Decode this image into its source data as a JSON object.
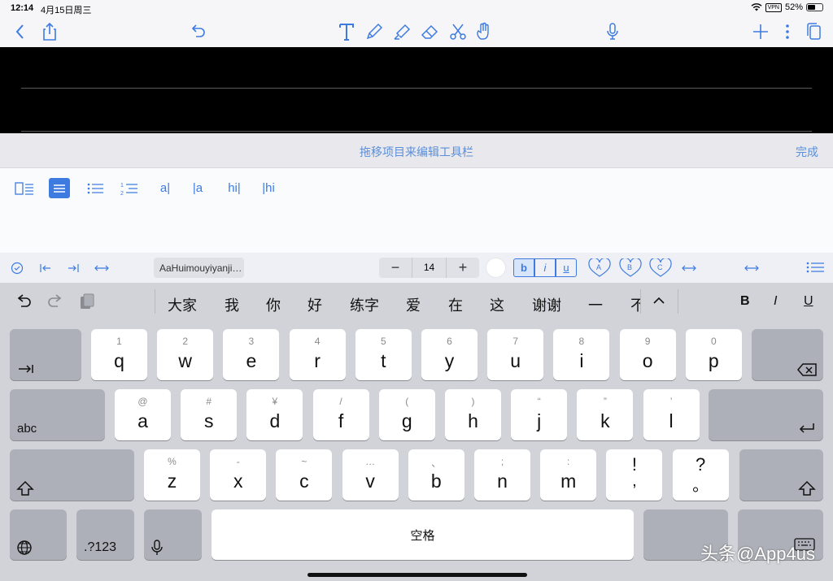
{
  "status": {
    "time": "12:14",
    "date": "4月15日周三",
    "vpn": "VPN",
    "battery_text": "52%",
    "battery_level": 0.52
  },
  "edit_bar": {
    "title": "拖移项目来编辑工具栏",
    "done": "完成"
  },
  "palette": {
    "items": [
      "a|",
      "|a",
      "hi|",
      "|hi"
    ]
  },
  "format": {
    "font_name": "AaHuimouyiyanji…",
    "font_size": "14",
    "minus": "−",
    "plus": "+",
    "bold": "b",
    "italic": "i",
    "underline": "u",
    "style_a": "A",
    "style_b": "B",
    "style_c": "C"
  },
  "candidates": {
    "words": [
      "大家",
      "我",
      "你",
      "好",
      "练字",
      "爱",
      "在",
      "这",
      "谢谢",
      "一",
      "不"
    ],
    "bold": "B",
    "italic": "I",
    "underline": "U"
  },
  "keyboard": {
    "row1": [
      [
        "1",
        "q"
      ],
      [
        "2",
        "w"
      ],
      [
        "3",
        "e"
      ],
      [
        "4",
        "r"
      ],
      [
        "5",
        "t"
      ],
      [
        "6",
        "y"
      ],
      [
        "7",
        "u"
      ],
      [
        "8",
        "i"
      ],
      [
        "9",
        "o"
      ],
      [
        "0",
        "p"
      ]
    ],
    "row2": [
      [
        "@",
        "a"
      ],
      [
        "#",
        "s"
      ],
      [
        "¥",
        "d"
      ],
      [
        "/",
        "f"
      ],
      [
        "(",
        "g"
      ],
      [
        ")",
        "h"
      ],
      [
        "“",
        "j"
      ],
      [
        "”",
        "k"
      ],
      [
        "’",
        "l"
      ]
    ],
    "row3": [
      [
        "%",
        "z"
      ],
      [
        "-",
        "x"
      ],
      [
        "~",
        "c"
      ],
      [
        "…",
        "v"
      ],
      [
        "、",
        "b"
      ],
      [
        ";",
        "n"
      ],
      [
        ":",
        "m"
      ],
      [
        "!",
        ","
      ],
      [
        "?",
        "。"
      ]
    ],
    "abc_label": "abc",
    "num_label": ".?123",
    "space_label": "空格"
  },
  "watermark": "头条@App4us",
  "colors": {
    "accent": "#3d7be0",
    "keyboard_bg": "#d1d3d9"
  }
}
